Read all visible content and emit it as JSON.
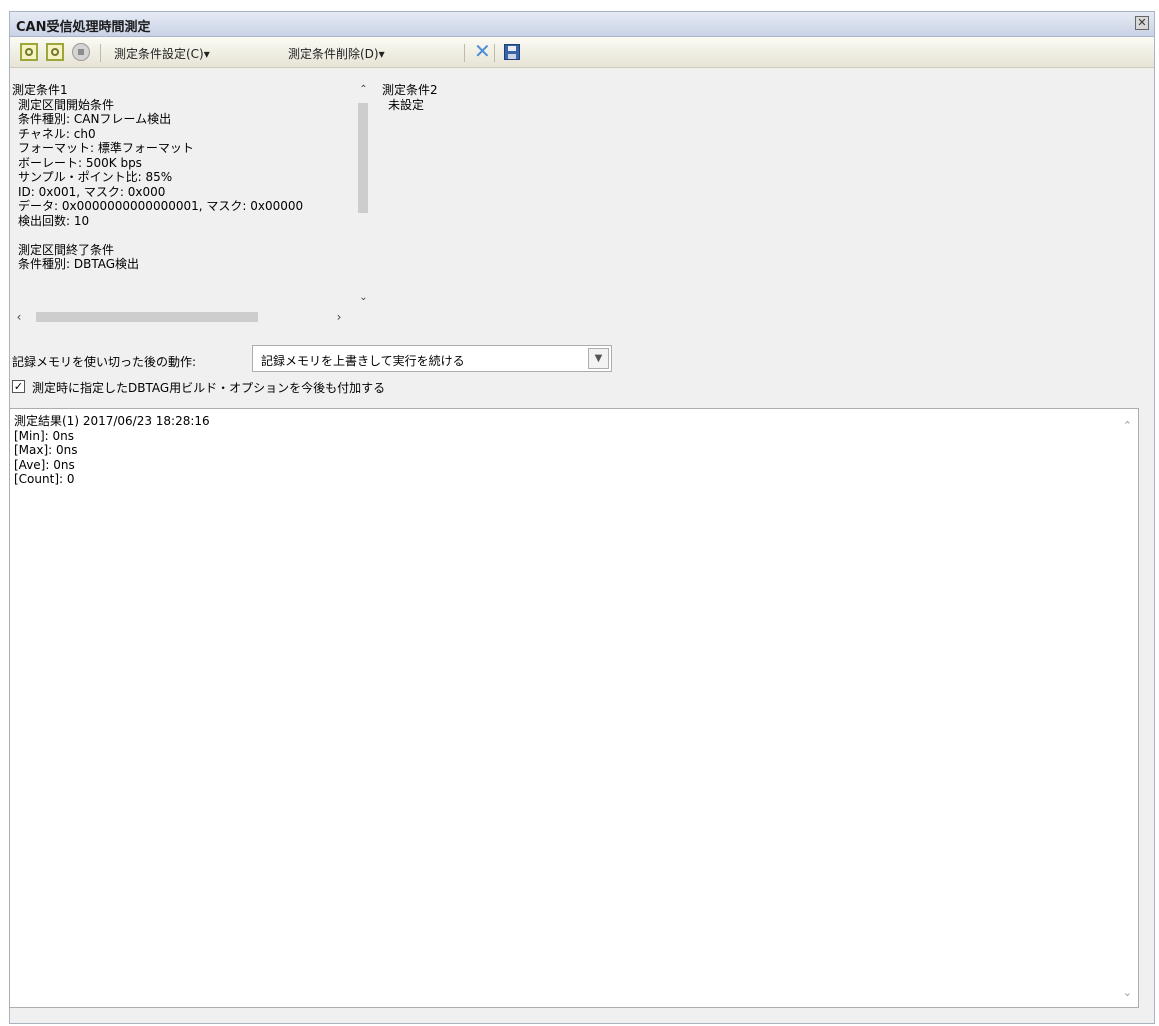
{
  "window": {
    "title": "CAN受信処理時間測定",
    "close_icon": "✕"
  },
  "toolbar": {
    "start_icon": "measure-start-icon",
    "start2_icon": "measure-start-with-condition-icon",
    "stop_icon": "measure-stop-icon",
    "set_condition_label": "測定条件設定(C)▾",
    "delete_condition_label": "測定条件削除(D)▾",
    "delete_icon": "✕",
    "save_icon": "save-icon"
  },
  "condition1": {
    "lines": [
      "測定条件1",
      "測定区間開始条件",
      "条件種別: CANフレーム検出",
      "チャネル: ch0",
      "フォーマット: 標準フォーマット",
      "ボーレート: 500K bps",
      "サンプル・ポイント比: 85%",
      "ID: 0x001, マスク: 0x000",
      "データ: 0x0000000000000001, マスク: 0x00000",
      "検出回数: 10",
      "",
      "測定区間終了条件",
      "条件種別: DBTAG検出"
    ]
  },
  "condition2": {
    "lines": [
      "測定条件2",
      "未設定"
    ]
  },
  "behavior": {
    "label": "記録メモリを使い切った後の動作:",
    "value": "記録メモリを上書きして実行を続ける"
  },
  "option": {
    "checked": true,
    "label": "測定時に指定したDBTAG用ビルド・オプションを今後も付加する"
  },
  "results": {
    "lines": [
      "測定結果(1) 2017/06/23 18:28:16",
      "[Min]: 0ns",
      "[Max]: 0ns",
      "[Ave]: 0ns",
      "[Count]: 0"
    ]
  }
}
